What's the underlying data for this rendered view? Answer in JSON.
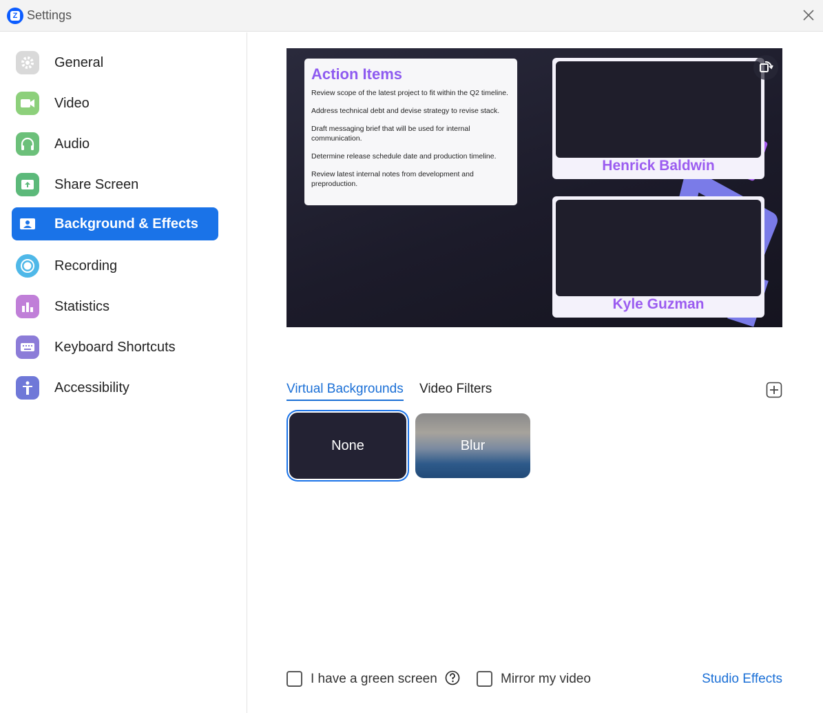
{
  "window": {
    "title": "Settings",
    "logo_letter": "Z"
  },
  "sidebar": {
    "items": [
      {
        "label": "General",
        "icon": "gear-icon",
        "color": "#d9d9d9"
      },
      {
        "label": "Video",
        "icon": "video-camera-icon",
        "color": "#8dd07b"
      },
      {
        "label": "Audio",
        "icon": "headphones-icon",
        "color": "#6cc07a"
      },
      {
        "label": "Share Screen",
        "icon": "share-screen-icon",
        "color": "#5cb97a"
      },
      {
        "label": "Background & Effects",
        "icon": "person-background-icon",
        "color": "#1a73e8",
        "active": true
      },
      {
        "label": "Recording",
        "icon": "record-icon",
        "color": "#4fb8e8"
      },
      {
        "label": "Statistics",
        "icon": "bar-chart-icon",
        "color": "#c07fd8"
      },
      {
        "label": "Keyboard Shortcuts",
        "icon": "keyboard-icon",
        "color": "#8c7cd8"
      },
      {
        "label": "Accessibility",
        "icon": "accessibility-icon",
        "color": "#6f78d8"
      }
    ]
  },
  "preview": {
    "slide": {
      "title": "Action Items",
      "items": [
        "Review scope of the latest project to fit within the Q2 timeline.",
        "Address technical debt and devise strategy to revise stack.",
        "Draft messaging brief that will be used for internal communication.",
        "Determine release schedule date and production timeline.",
        "Review latest internal notes from development and preproduction."
      ]
    },
    "participants": [
      "Henrick Baldwin",
      "Kyle Guzman"
    ]
  },
  "tabs": [
    {
      "label": "Virtual Backgrounds",
      "active": true
    },
    {
      "label": "Video Filters",
      "active": false
    }
  ],
  "backgrounds": [
    {
      "label": "None",
      "selected": true
    },
    {
      "label": "Blur",
      "selected": false
    }
  ],
  "footer": {
    "green_screen_label": "I have a green screen",
    "green_screen_checked": false,
    "mirror_label": "Mirror my video",
    "mirror_checked": false,
    "studio_effects_label": "Studio Effects"
  },
  "colors": {
    "accent": "#1a73e8",
    "link": "#1a6fd6",
    "participant_name": "#9b5cf0"
  }
}
